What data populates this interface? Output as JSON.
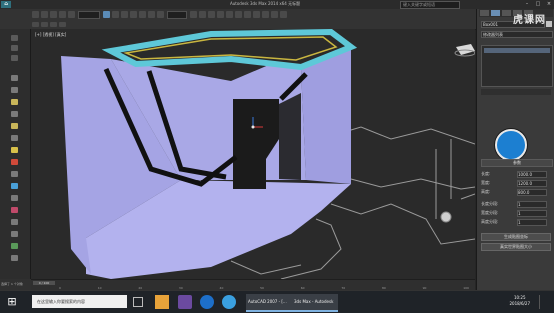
{
  "window": {
    "title": "Autodesk 3ds Max 2014 x64  无标题",
    "search_text": "键入关键字或短语"
  },
  "viewport": {
    "label": "[+] [透视] [真实]"
  },
  "command_panel": {
    "object_name": "Box001",
    "section_modifier_list": "修改器列表",
    "section_params": "参数",
    "rows": [
      "长度:",
      "宽度:",
      "高度:",
      "长度分段:",
      "宽度分段:",
      "高度分段:"
    ],
    "values": [
      "1000.0",
      "1200.0",
      "800.0",
      "1",
      "1",
      "1"
    ],
    "buttons": [
      "生成贴图坐标",
      "真实世界贴图大小"
    ]
  },
  "timeline": {
    "frame": "0 / 100",
    "ticks": [
      "0",
      "10",
      "20",
      "30",
      "40",
      "50",
      "60",
      "70",
      "80",
      "90",
      "100"
    ]
  },
  "status": {
    "text": "选择了 1 个对象"
  },
  "taskbar": {
    "search_placeholder": "在这里输入你要搜索的内容",
    "apps": [
      "AutoCAD 2007 - [...",
      "3ds Max - Autodesk"
    ],
    "time": "10:25",
    "date": "2018/6/27"
  },
  "watermark": {
    "text": "虎课网"
  },
  "colors": {
    "wall": "#a9a8e6",
    "wall_light": "#c0bff0",
    "cyan_frame": "#5ec8d8",
    "selection_blue": "#1c7fd1"
  }
}
